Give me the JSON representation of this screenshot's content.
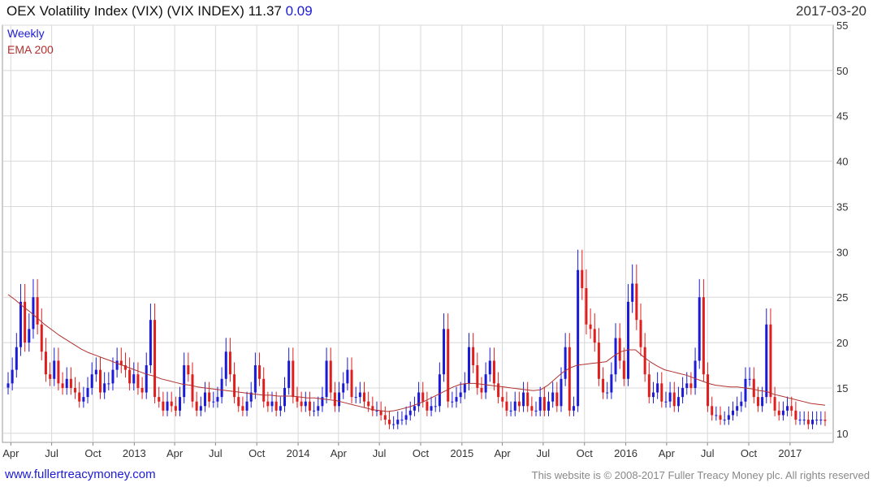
{
  "header": {
    "title": "OEX Volatility Index (VIX) (VIX INDEX) 11.37",
    "change": "0.09",
    "date": "2017-03-20"
  },
  "legend": [
    {
      "label": "Weekly",
      "color": "#1b1bd6"
    },
    {
      "label": "EMA 200",
      "color": "#b03030"
    }
  ],
  "footer": {
    "link": "www.fullertreacymoney.com",
    "copyright": "This website is © 2008-2017 Fuller Treacy Money plc. All rights reserved"
  },
  "colors": {
    "up": "#1b1bd6",
    "down": "#e01e1e",
    "ema": "#b03030",
    "grid": "#d8d8d8"
  },
  "chart_data": {
    "type": "bar",
    "subtype": "weekly candlestick (hollow bars) with EMA 200",
    "ylim": [
      9,
      55
    ],
    "y_ticks": [
      10,
      15,
      20,
      25,
      30,
      35,
      40,
      45,
      50,
      55
    ],
    "x_start": "2012-03-26",
    "x_end": "2017-03-20",
    "x_ticks": [
      {
        "label": "Apr",
        "date": "2012-04-01"
      },
      {
        "label": "Jul",
        "date": "2012-07-01"
      },
      {
        "label": "Oct",
        "date": "2012-10-01"
      },
      {
        "label": "2013",
        "date": "2013-01-01"
      },
      {
        "label": "Apr",
        "date": "2013-04-01"
      },
      {
        "label": "Jul",
        "date": "2013-07-01"
      },
      {
        "label": "Oct",
        "date": "2013-10-01"
      },
      {
        "label": "2014",
        "date": "2014-01-01"
      },
      {
        "label": "Apr",
        "date": "2014-04-01"
      },
      {
        "label": "Jul",
        "date": "2014-07-01"
      },
      {
        "label": "Oct",
        "date": "2014-10-01"
      },
      {
        "label": "2015",
        "date": "2015-01-01"
      },
      {
        "label": "Apr",
        "date": "2015-04-01"
      },
      {
        "label": "Jul",
        "date": "2015-07-01"
      },
      {
        "label": "Oct",
        "date": "2015-10-01"
      },
      {
        "label": "2016",
        "date": "2016-01-01"
      },
      {
        "label": "Apr",
        "date": "2016-04-01"
      },
      {
        "label": "Jul",
        "date": "2016-07-01"
      },
      {
        "label": "Oct",
        "date": "2016-10-01"
      },
      {
        "label": "2017",
        "date": "2017-01-01"
      }
    ],
    "series": [
      {
        "name": "Weekly",
        "values_close": [
          15.5,
          17.0,
          19.5,
          24.5,
          20.0,
          21.5,
          25.0,
          22.0,
          19.0,
          16.5,
          16.0,
          18.0,
          15.5,
          15.0,
          16.0,
          15.0,
          14.5,
          13.5,
          14.0,
          15.0,
          16.5,
          17.0,
          14.5,
          15.5,
          15.5,
          17.0,
          18.0,
          17.5,
          17.0,
          15.5,
          16.5,
          15.0,
          14.5,
          17.5,
          22.5,
          14.0,
          13.5,
          12.5,
          13.5,
          13.0,
          12.5,
          14.0,
          17.5,
          16.5,
          13.5,
          12.5,
          13.0,
          14.5,
          13.5,
          13.5,
          14.0,
          16.0,
          19.0,
          16.5,
          14.0,
          13.0,
          12.5,
          13.5,
          14.5,
          17.5,
          16.0,
          13.5,
          13.0,
          13.5,
          12.5,
          13.0,
          15.0,
          18.0,
          14.0,
          13.5,
          13.0,
          13.5,
          12.5,
          12.5,
          13.0,
          14.0,
          18.0,
          14.5,
          13.0,
          14.5,
          15.5,
          17.0,
          14.0,
          14.0,
          14.5,
          13.5,
          13.0,
          12.5,
          12.5,
          12.0,
          11.5,
          11.0,
          11.0,
          11.5,
          11.5,
          12.0,
          12.5,
          13.0,
          14.5,
          13.5,
          12.5,
          13.0,
          13.0,
          16.5,
          21.5,
          13.5,
          13.5,
          14.0,
          14.5,
          15.5,
          19.5,
          17.5,
          15.0,
          14.5,
          16.5,
          18.0,
          15.5,
          14.0,
          13.5,
          12.5,
          12.5,
          13.5,
          13.0,
          14.5,
          13.0,
          12.5,
          12.5,
          14.0,
          12.5,
          13.5,
          14.5,
          13.0,
          16.0,
          19.5,
          12.5,
          13.0,
          28.0,
          26.0,
          22.0,
          21.5,
          20.0,
          16.0,
          14.5,
          14.5,
          16.5,
          20.5,
          18.0,
          16.0,
          24.5,
          26.5,
          22.5,
          19.5,
          16.5,
          14.0,
          14.5,
          15.5,
          13.5,
          13.5,
          14.5,
          13.0,
          14.0,
          15.0,
          15.5,
          15.0,
          18.0,
          25.0,
          16.5,
          13.0,
          12.0,
          12.0,
          11.5,
          11.5,
          12.0,
          12.5,
          13.0,
          13.5,
          16.0,
          16.0,
          14.0,
          13.0,
          14.0,
          22.0,
          14.0,
          12.5,
          12.0,
          12.5,
          13.0,
          12.5,
          11.5,
          11.5,
          11.5,
          11.0,
          11.5,
          11.5,
          11.5,
          11.37
        ]
      }
    ],
    "ema_200": [
      25.3,
      24.7,
      24.0,
      23.4,
      22.7,
      22.0,
      21.4,
      20.8,
      20.3,
      19.8,
      19.3,
      18.9,
      18.6,
      18.3,
      18.0,
      17.7,
      17.4,
      17.1,
      16.8,
      16.5,
      16.3,
      16.0,
      15.8,
      15.6,
      15.4,
      15.3,
      15.1,
      15.0,
      14.9,
      14.8,
      14.7,
      14.6,
      14.5,
      14.4,
      14.3,
      14.2,
      14.2,
      14.1,
      14.1,
      14.1,
      14.0,
      13.9,
      13.9,
      13.8,
      13.7,
      13.6,
      13.4,
      13.2,
      13.0,
      12.8,
      12.6,
      12.5,
      12.4,
      12.5,
      12.7,
      12.9,
      13.2,
      13.5,
      13.9,
      14.3,
      14.7,
      15.1,
      15.4,
      15.5,
      15.5,
      15.4,
      15.3,
      15.2,
      15.1,
      15.0,
      14.9,
      14.8,
      14.7,
      14.8,
      15.3,
      16.0,
      16.7,
      17.2,
      17.5,
      17.6,
      17.7,
      17.8,
      17.9,
      18.5,
      19.0,
      19.2,
      19.2,
      18.5,
      17.9,
      17.4,
      17.0,
      16.8,
      16.6,
      16.4,
      16.1,
      15.8,
      15.5,
      15.3,
      15.2,
      15.1,
      15.1,
      15.0,
      14.9,
      14.7,
      14.6,
      14.3,
      14.1,
      13.9,
      13.7,
      13.5,
      13.3,
      13.2,
      13.1
    ]
  }
}
